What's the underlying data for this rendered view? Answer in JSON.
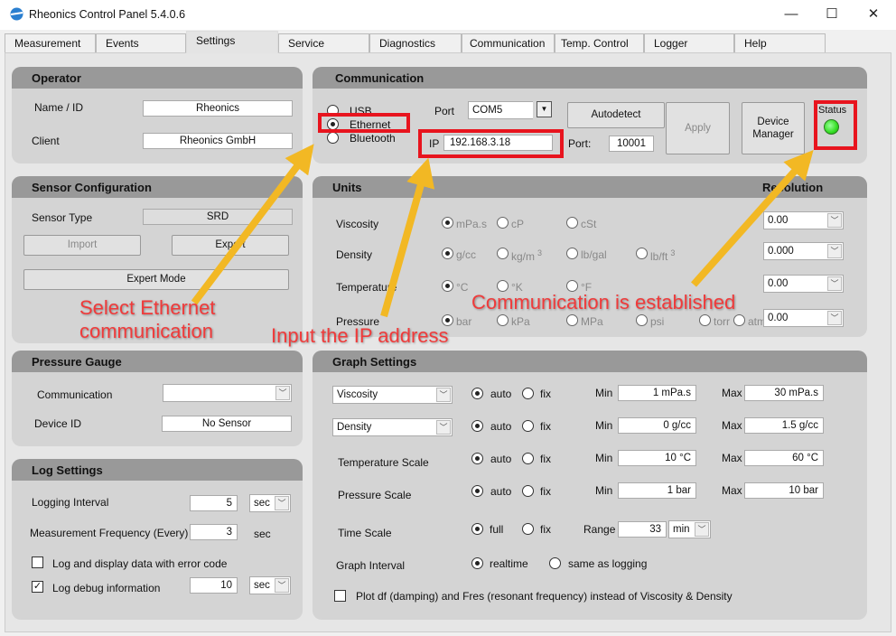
{
  "window": {
    "title": "Rheonics Control Panel 5.4.0.6",
    "minimize": "—",
    "maximize": "☐",
    "close": "✕"
  },
  "tabs": [
    "Measurement",
    "Events",
    "Settings",
    "Service",
    "Diagnostics",
    "Communication",
    "Temp. Control",
    "Logger",
    "Help"
  ],
  "active_tab": "Settings",
  "operator": {
    "title": "Operator",
    "name_label": "Name / ID",
    "name_value": "Rheonics",
    "client_label": "Client",
    "client_value": "Rheonics GmbH"
  },
  "sensor": {
    "title": "Sensor Configuration",
    "type_label": "Sensor Type",
    "type_value": "SRD",
    "import": "Import",
    "export": "Export",
    "expert": "Expert Mode"
  },
  "pressure_gauge": {
    "title": "Pressure Gauge",
    "comm_label": "Communication",
    "comm_value": "",
    "device_label": "Device ID",
    "device_value": "No Sensor"
  },
  "log": {
    "title": "Log Settings",
    "interval_label": "Logging Interval",
    "interval_value": "5",
    "interval_unit": "sec",
    "freq_label": "Measurement Frequency (Every)",
    "freq_value": "3",
    "freq_unit": "sec",
    "error_label": "Log and display data with error code",
    "error_checked": false,
    "debug_label": "Log debug information",
    "debug_checked": true,
    "debug_value": "10",
    "debug_unit": "sec"
  },
  "communication": {
    "title": "Communication",
    "usb": "USB",
    "ethernet": "Ethernet",
    "bluetooth": "Bluetooth",
    "selected": "Ethernet",
    "port_label": "Port",
    "port_value": "COM5",
    "ip_label": "IP",
    "ip_value": "192.168.3.18",
    "autodetect": "Autodetect",
    "port2_label": "Port:",
    "port2_value": "10001",
    "apply": "Apply",
    "device_manager": "Device Manager",
    "status_label": "Status",
    "status_color": "#33dd22"
  },
  "units": {
    "title": "Units",
    "resolution_title": "Resolution",
    "rows": [
      {
        "label": "Viscosity",
        "options": [
          "mPa.s",
          "cP",
          "cSt"
        ],
        "resolution": "0.00"
      },
      {
        "label": "Density",
        "options": [
          "g/cc",
          "kg/m",
          "lb/gal",
          "lb/ft"
        ],
        "superscripts": [
          "",
          "3",
          "",
          "3"
        ],
        "resolution": "0.000"
      },
      {
        "label": "Temperature",
        "options": [
          "°C",
          "°K",
          "°F"
        ],
        "resolution": "0.00"
      },
      {
        "label": "Pressure",
        "options": [
          "bar",
          "kPa",
          "MPa",
          "psi",
          "torr",
          "atm"
        ],
        "resolution": "0.00"
      }
    ]
  },
  "graph": {
    "title": "Graph Settings",
    "rows": [
      {
        "label": "Viscosity",
        "min": "1 mPa.s",
        "max": "30 mPa.s"
      },
      {
        "label": "Density",
        "min": "0 g/cc",
        "max": "1.5 g/cc"
      },
      {
        "label": "Temperature Scale",
        "min": "10 °C",
        "max": "60 °C"
      },
      {
        "label": "Pressure Scale",
        "min": "1 bar",
        "max": "10 bar"
      }
    ],
    "auto": "auto",
    "fix": "fix",
    "min_label": "Min",
    "max_label": "Max",
    "time_label": "Time Scale",
    "full": "full",
    "range_label": "Range",
    "range_value": "33",
    "range_unit": "min",
    "interval_label": "Graph Interval",
    "realtime": "realtime",
    "same_as_logging": "same as logging",
    "plot_df_label": "Plot df (damping) and Fres (resonant frequency) instead of Viscosity & Density",
    "plot_df_checked": false
  },
  "annotations": {
    "ethernet": "Select Ethernet communication",
    "ip": "Input the IP address",
    "status": "Communication is established",
    "highlight_color": "#e8141e",
    "arrow_color": "#f2b824"
  }
}
